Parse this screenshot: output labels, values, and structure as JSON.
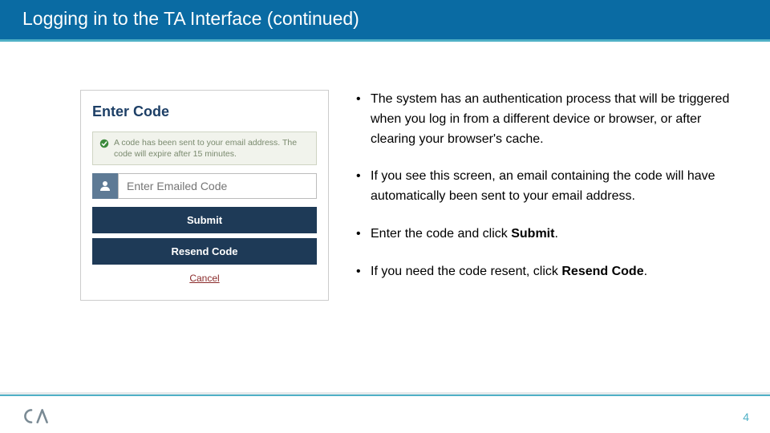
{
  "header": {
    "title": "Logging in to the TA Interface (continued)"
  },
  "panel": {
    "title": "Enter Code",
    "info": "A code has been sent to your email address. The code will expire after 15 minutes.",
    "placeholder": "Enter Emailed Code",
    "submit": "Submit",
    "resend": "Resend Code",
    "cancel": "Cancel"
  },
  "bullets": {
    "b1": "The system has an authentication process that will be triggered when you log in from a different device or browser, or after clearing your browser's cache.",
    "b2": "If you see this screen, an email containing the code will have automatically been sent to your email address.",
    "b3_pre": "Enter the code and click ",
    "b3_bold": "Submit",
    "b3_post": ".",
    "b4_pre": "If you need the code resent, click ",
    "b4_bold": "Resend Code",
    "b4_post": "."
  },
  "footer": {
    "page": "4"
  }
}
